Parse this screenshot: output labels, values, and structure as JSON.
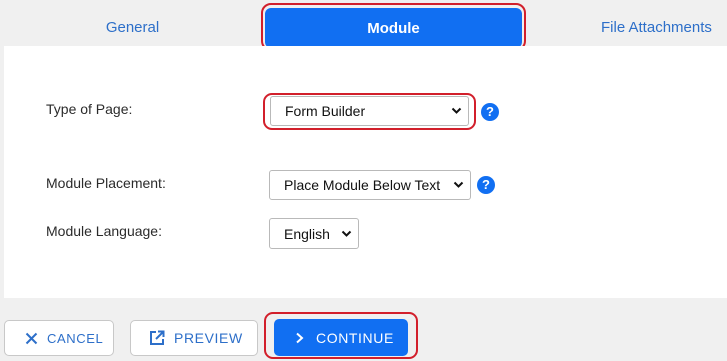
{
  "tabs": {
    "general": "General",
    "module": "Module",
    "files": "File Attachments"
  },
  "form": {
    "type_of_page_label": "Type of Page:",
    "type_of_page_value": "Form Builder",
    "placement_label": "Module Placement:",
    "placement_value": "Place Module Below Text",
    "language_label": "Module Language:",
    "language_value": "English",
    "help_glyph": "?"
  },
  "footer": {
    "cancel_label": "CANCEL",
    "preview_label": "PREVIEW",
    "continue_label": "CONTINUE"
  },
  "icons": {
    "cancel": "close-icon",
    "preview": "external-link-icon",
    "continue": "chevron-right-icon",
    "select": "chevron-down-icon",
    "help": "question-icon"
  },
  "colors": {
    "accent": "#116ff2",
    "link": "#2d6fc9",
    "highlight": "#d21f2b",
    "background": "#f0f0f0",
    "panel": "#ffffff"
  }
}
